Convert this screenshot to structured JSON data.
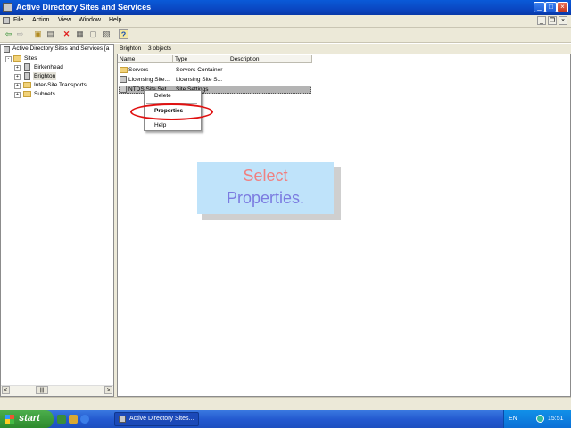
{
  "window": {
    "title": "Active Directory Sites and Services",
    "controls": {
      "minimize": "_",
      "maximize": "□",
      "close": "×"
    }
  },
  "menubar": {
    "items": [
      "File",
      "Action",
      "View",
      "Window",
      "Help"
    ],
    "mdi_controls": {
      "minimize": "_",
      "restore": "❐",
      "close": "×"
    }
  },
  "toolbar": {
    "icons": [
      "back-icon",
      "forward-icon",
      "up-folder-icon",
      "show-tree-icon",
      "delete-icon",
      "properties-icon",
      "copy-icon",
      "export-list-icon",
      "help-icon"
    ],
    "glyphs": {
      "back": "⇦",
      "forward": "⇨",
      "up": "▣",
      "tree": "▤",
      "delete": "✕",
      "properties": "▦",
      "copy": "▢",
      "export": "▧",
      "help": "?"
    },
    "delete_color": "#e02020"
  },
  "tree": {
    "root": "Active Directory Sites and Services [a",
    "items": [
      {
        "label": "Sites",
        "expander": "-"
      },
      {
        "label": "Birkenhead",
        "expander": "+"
      },
      {
        "label": "Brighton",
        "expander": "+"
      },
      {
        "label": "Inter-Site Transports",
        "expander": "+"
      },
      {
        "label": "Subnets",
        "expander": "+"
      }
    ]
  },
  "list": {
    "caption_title": "Brighton",
    "caption_count": "3 objects",
    "columns": [
      "Name",
      "Type",
      "Description"
    ],
    "rows": [
      {
        "name": "Servers",
        "type": "Servers Container",
        "description": ""
      },
      {
        "name": "Licensing Site...",
        "type": "Licensing Site S...",
        "description": ""
      },
      {
        "name": "NTDS Site Set...",
        "type": "Site Settings",
        "description": ""
      }
    ]
  },
  "context_menu": {
    "items": [
      "Delete",
      "Properties",
      "Help"
    ],
    "highlight_color": "#e01010"
  },
  "callout": {
    "line1": "Select",
    "line2": "Properties.",
    "background": "#bfe3fa"
  },
  "taskbar": {
    "start_label": "start",
    "task_label": "Active Directory Sites...",
    "language": "EN",
    "clock": "15:51"
  },
  "scrollbar": {
    "left": "<",
    "thumb": "|||",
    "right": ">"
  }
}
